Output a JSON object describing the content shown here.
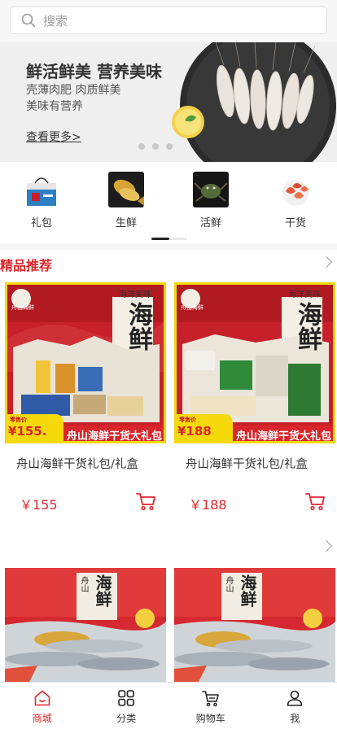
{
  "search": {
    "placeholder": "搜索"
  },
  "banner": {
    "title": "鲜活鲜美 营养美味",
    "line1": "壳薄肉肥  肉质鲜美",
    "line2": "美味有营养",
    "more_link": "查看更多>"
  },
  "categories": [
    {
      "label": "礼包",
      "icon": "gift-bag-icon"
    },
    {
      "label": "生鲜",
      "icon": "fresh-fish-icon"
    },
    {
      "label": "活鲜",
      "icon": "live-crab-icon"
    },
    {
      "label": "干货",
      "icon": "dried-shrimp-icon"
    }
  ],
  "section": {
    "title": "精品推荐"
  },
  "products": [
    {
      "name": "舟山海鲜干货礼包/礼盒",
      "price": "￥155",
      "image": {
        "box_title": "海鲜",
        "corner_text": "海洋美味",
        "brand": "舟山海鲜",
        "retail_label": "零售价",
        "retail_price": "¥155.",
        "banner_text": "舟山海鲜干货大礼包"
      }
    },
    {
      "name": "舟山海鲜干货礼包/礼盒",
      "price": "￥188",
      "image": {
        "box_title": "海鲜",
        "corner_text": "海洋美味",
        "brand": "舟山海鲜",
        "retail_label": "零售价",
        "retail_price": "¥188",
        "banner_text": "舟山海鲜干货大礼包"
      }
    },
    {
      "image": {
        "box_title": "海鲜",
        "brand": "舟山"
      }
    },
    {
      "image": {
        "box_title": "海鲜",
        "brand": "舟山"
      }
    }
  ],
  "tabs": [
    {
      "label": "商城",
      "icon": "home-icon",
      "active": true
    },
    {
      "label": "分类",
      "icon": "grid-icon",
      "active": false
    },
    {
      "label": "购物车",
      "icon": "cart-icon",
      "active": false
    },
    {
      "label": "我",
      "icon": "user-icon",
      "active": false
    }
  ],
  "colors": {
    "accent": "#e0262c",
    "section_title": "#d9262a",
    "box_red": "#c8202a",
    "box_yellow": "#f5d90a"
  }
}
